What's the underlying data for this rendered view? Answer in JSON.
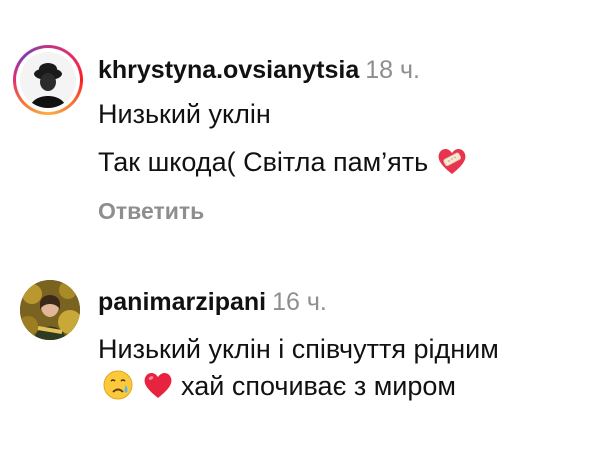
{
  "comments": [
    {
      "username": "khrystyna.ovsianytsia",
      "time": "18 ч.",
      "lines": [
        "Низький уклін",
        "Так шкода( Світла пам’ять"
      ],
      "emoji": "mending-heart-icon",
      "reply_label": "Ответить",
      "avatar_ring": true
    },
    {
      "username": "panimarzipani",
      "time": "16 ч.",
      "text_part1": "Низький уклін і співчуття рідним",
      "emojis": [
        "crying-face-icon",
        "red-heart-icon"
      ],
      "text_part2": "хай спочиває з миром",
      "avatar_ring": false
    }
  ],
  "colors": {
    "username": "#111111",
    "muted": "#8e8e8e",
    "heart": "#e0245e"
  }
}
